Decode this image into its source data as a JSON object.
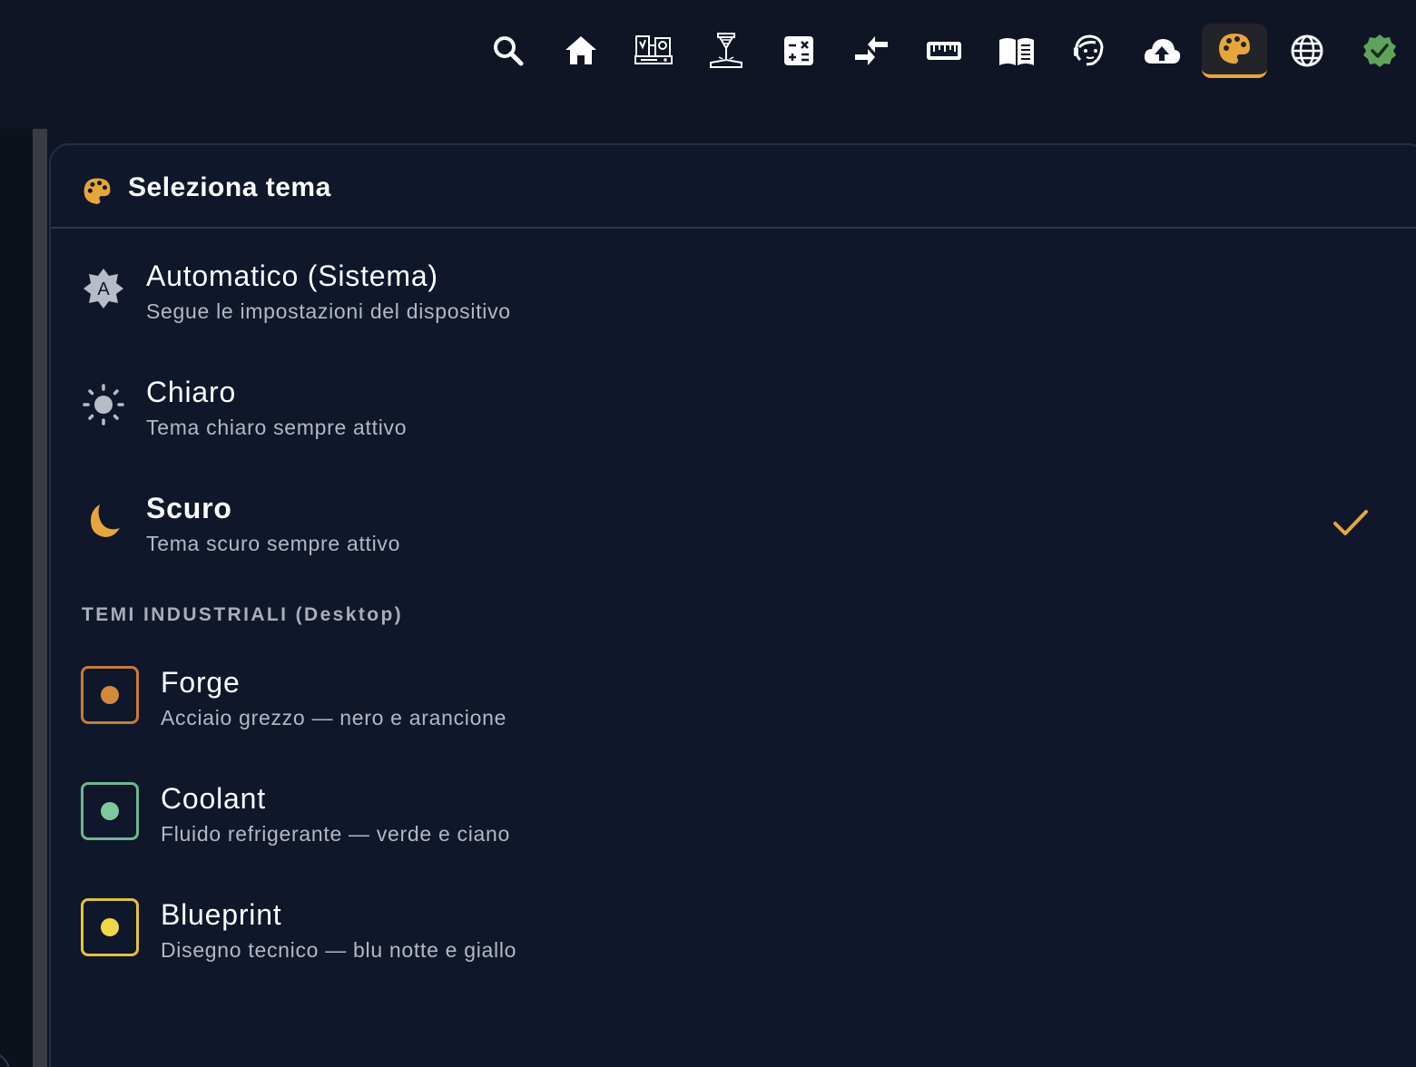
{
  "toolbar": {
    "icons": [
      "search-icon",
      "home-icon",
      "machine-icon",
      "laser-icon",
      "calculator-icon",
      "compare-icon",
      "ruler-icon",
      "manual-icon",
      "support-icon",
      "cloud-upload-icon",
      "palette-icon",
      "globe-icon",
      "verified-icon"
    ],
    "active": "palette-icon"
  },
  "panel": {
    "title": "Seleziona tema",
    "options": [
      {
        "title": "Automatico (Sistema)",
        "subtitle": "Segue le impostazioni del dispositivo",
        "icon": "auto-brightness-icon"
      },
      {
        "title": "Chiaro",
        "subtitle": "Tema chiaro sempre attivo",
        "icon": "sun-icon"
      },
      {
        "title": "Scuro",
        "subtitle": "Tema scuro sempre attivo",
        "icon": "moon-icon",
        "selected": true
      }
    ],
    "section_label": "TEMI INDUSTRIALI (Desktop)",
    "industrial_options": [
      {
        "title": "Forge",
        "subtitle": "Acciaio grezzo — nero e arancione",
        "border": "#c47d35",
        "dot": "#d08b3a"
      },
      {
        "title": "Coolant",
        "subtitle": "Fluido refrigerante — verde e ciano",
        "border": "#6ab891",
        "dot": "#7fc89f"
      },
      {
        "title": "Blueprint",
        "subtitle": "Disegno tecnico — blu notte e giallo",
        "border": "#e2c43c",
        "dot": "#f0d848"
      }
    ]
  },
  "colors": {
    "background": "#0f1524",
    "panel": "#10172a",
    "accent": "#e6a63b",
    "text_secondary": "#b3b8c4",
    "verified": "#5ea35a"
  }
}
